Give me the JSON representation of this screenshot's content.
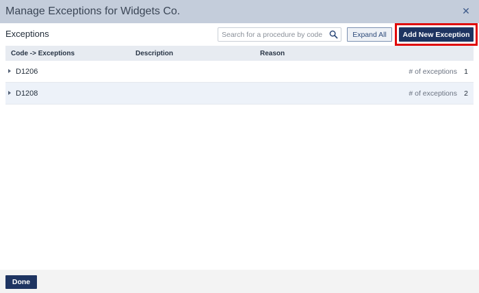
{
  "dialog": {
    "title": "Manage Exceptions for Widgets Co.",
    "close_icon": "close-icon"
  },
  "section": {
    "title": "Exceptions"
  },
  "search": {
    "placeholder": "Search for a procedure by code",
    "value": "",
    "icon": "search-icon"
  },
  "toolbar": {
    "expand_all_label": "Expand All",
    "add_new_label": "Add New Exception"
  },
  "table": {
    "columns": [
      "Code -> Exceptions",
      "Description",
      "Reason"
    ],
    "rows": [
      {
        "code": "D1206",
        "count_label": "# of exceptions",
        "count": "1"
      },
      {
        "code": "D1208",
        "count_label": "# of exceptions",
        "count": "2"
      }
    ]
  },
  "footer": {
    "done_label": "Done"
  },
  "colors": {
    "primary": "#1e3461",
    "highlight": "#e00000",
    "titlebar": "#c4cddb"
  }
}
